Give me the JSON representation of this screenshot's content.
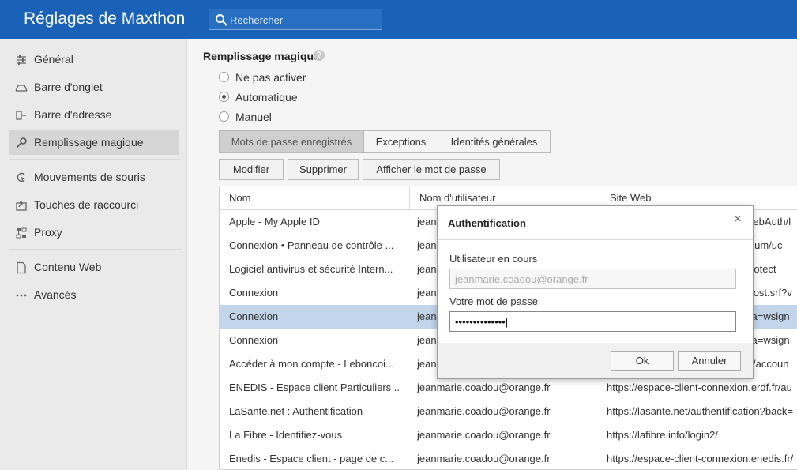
{
  "app": {
    "title": "Réglages de Maxthon"
  },
  "search": {
    "placeholder": "Rechercher"
  },
  "sidebar": {
    "items": [
      {
        "label": "Général",
        "icon": "sliders-icon"
      },
      {
        "label": "Barre d'onglet",
        "icon": "tab-icon"
      },
      {
        "label": "Barre d'adresse",
        "icon": "address-bar-icon"
      },
      {
        "label": "Remplissage magique",
        "icon": "key-icon",
        "active": true
      },
      {
        "label": "Mouvements de souris",
        "icon": "mouse-gesture-icon"
      },
      {
        "label": "Touches de raccourci",
        "icon": "shortcut-icon"
      },
      {
        "label": "Proxy",
        "icon": "proxy-icon"
      },
      {
        "label": "Contenu Web",
        "icon": "page-icon"
      },
      {
        "label": "Avancés",
        "icon": "more-icon"
      }
    ]
  },
  "main": {
    "section_title": "Remplissage magique",
    "help": "?",
    "options": [
      {
        "label": "Ne pas activer",
        "checked": false
      },
      {
        "label": "Automatique",
        "checked": true
      },
      {
        "label": "Manuel",
        "checked": false
      }
    ],
    "tabs": [
      {
        "label": "Mots de passe enregistrés",
        "active": true
      },
      {
        "label": "Exceptions",
        "active": false
      },
      {
        "label": "Identités générales",
        "active": false
      }
    ],
    "actions": {
      "modify": "Modifier",
      "delete": "Supprimer",
      "show_password": "Afficher le mot de passe"
    },
    "table": {
      "headers": [
        "Nom",
        "Nom d'utilisateur",
        "Site Web"
      ],
      "rows": [
        {
          "name": "Apple - My Apple ID",
          "user": "jeanmarie.coadou@orange.fr",
          "site": "https://idmsa.apple.com/IDMSWebAuth/l"
        },
        {
          "name": "Connexion • Panneau de contrôle ...",
          "user": "jeanmarie.coadou@orange.fr",
          "site": "https://www.example-forum.fr/forum/uc"
        },
        {
          "name": "Logiciel antivirus et sécurité Intern...",
          "user": "jeanmarie.coadou@orange.fr",
          "site": "https://www.antivirus-site.com/protect"
        },
        {
          "name": "Connexion",
          "user": "jeanmarie.coadou@orange.fr",
          "site": "https://login.live.com/ppsecure/post.srf?v"
        },
        {
          "name": "Connexion",
          "user": "jeanmarie.coadou@orange.fr",
          "site": "https://login.live.com/login.srf?wa=wsign",
          "selected": true
        },
        {
          "name": "Connexion",
          "user": "jeanmarie.coadou@orange.fr",
          "site": "https://login.live.com/login.srf?wa=wsign"
        },
        {
          "name": "Accéder à mon compte - Leboncoi...",
          "user": "jeanmarie.coadou@orange.fr",
          "site": "https://compteperso.leboncoin.fr/accoun"
        },
        {
          "name": "ENEDIS - Espace client Particuliers ...",
          "user": "jeanmarie.coadou@orange.fr",
          "site": "https://espace-client-connexion.erdf.fr/au"
        },
        {
          "name": "LaSante.net : Authentification",
          "user": "jeanmarie.coadou@orange.fr",
          "site": "https://lasante.net/authentification?back="
        },
        {
          "name": "La Fibre - Identifiez-vous",
          "user": "jeanmarie.coadou@orange.fr",
          "site": "https://lafibre.info/login2/"
        },
        {
          "name": "Enedis - Espace client - page de c...",
          "user": "jeanmarie.coadou@orange.fr",
          "site": "https://espace-client-connexion.enedis.fr/"
        }
      ]
    }
  },
  "dialog": {
    "title": "Authentification",
    "close": "×",
    "current_user_label": "Utilisateur en cours",
    "current_user_value": "jeanmarie.coadou@orange.fr",
    "password_label": "Votre mot de passe",
    "password_value": "••••••••••••••|",
    "ok": "Ok",
    "cancel": "Annuler"
  }
}
